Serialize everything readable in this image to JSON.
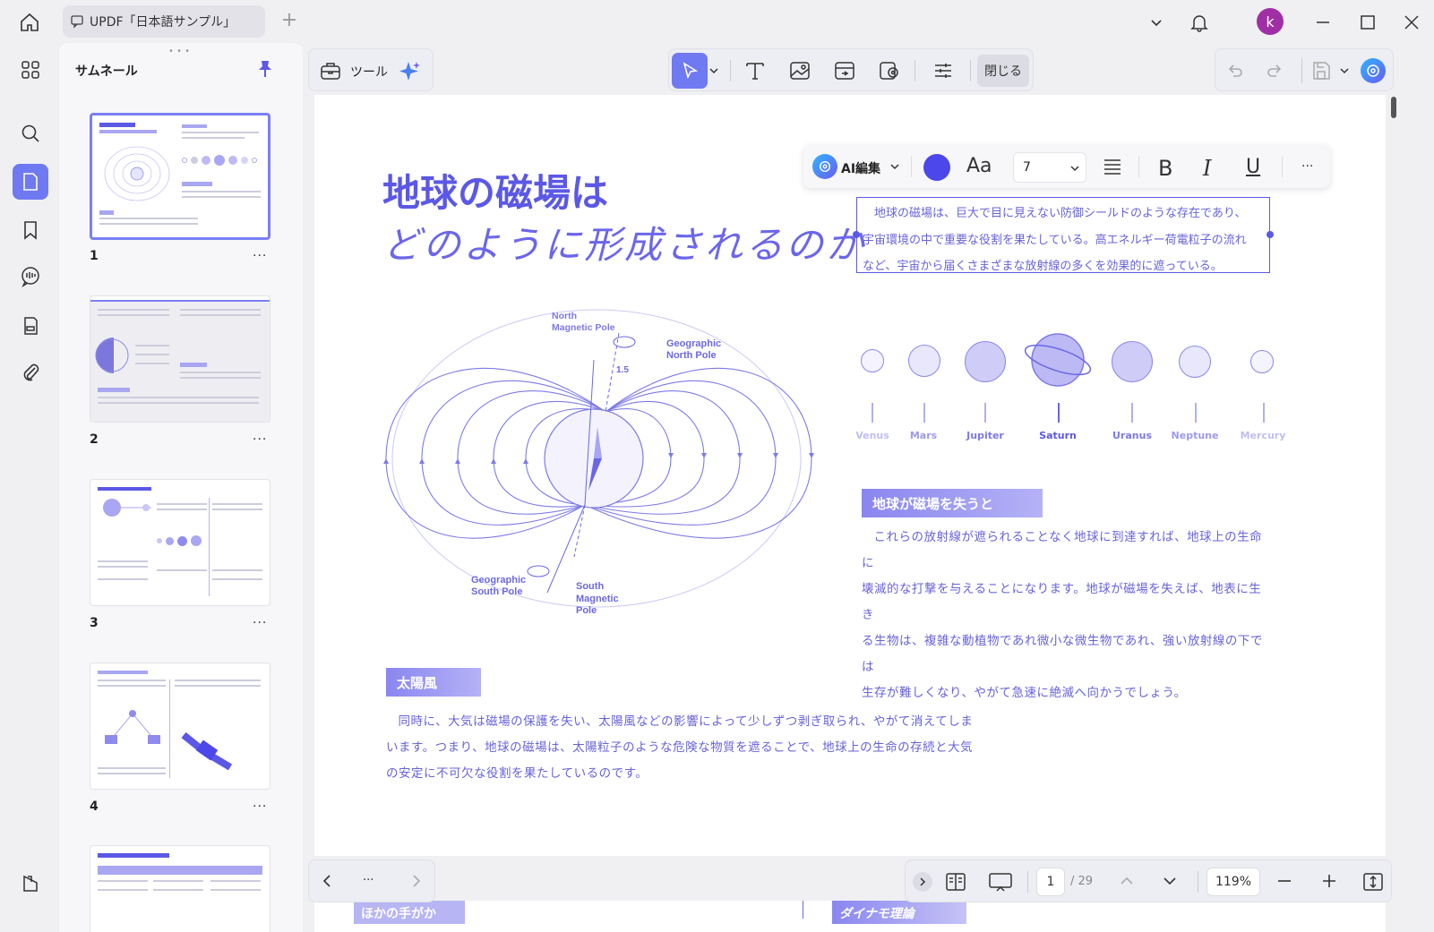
{
  "titlebar": {
    "tab_title": "UPDF「日本語サンプル」",
    "avatar_letter": "k"
  },
  "thumbnails": {
    "header": "サムネール",
    "pages": [
      {
        "number": "1",
        "more": "···"
      },
      {
        "number": "2",
        "more": "···"
      },
      {
        "number": "3",
        "more": "···"
      },
      {
        "number": "4",
        "more": "···"
      }
    ]
  },
  "toolbar": {
    "tools_label": "ツール",
    "close_label": "閉じる"
  },
  "format_bar": {
    "ai_edit_label": "AI編集",
    "font_label": "Aa",
    "font_size": "7",
    "text_color": "#4b47ea",
    "more": "···"
  },
  "document": {
    "title_line1": "地球の磁場は",
    "title_line2": "どのように形成されるのか",
    "intro_lines": [
      "地球の磁場は、巨大で目に見えない防御シールドのような存在であり、",
      "宇宙環境の中で重要な役割を果たしている。高エネルギー荷電粒子の流れ",
      "など、宇宙から届くさまざまな放射線の多くを効果的に遮っている。"
    ],
    "diagram_labels": {
      "north_magnetic_pole": [
        "North",
        "Magnetic Pole"
      ],
      "geographic_north_pole": [
        "Geographic",
        "North Pole"
      ],
      "geographic_south_pole": [
        "Geographic",
        "South Pole"
      ],
      "south_magnetic_pole": [
        "South",
        "Magnetic",
        "Pole"
      ],
      "angle": "1.5"
    },
    "planets": [
      "Venus",
      "Mars",
      "Jupiter",
      "Saturn",
      "Uranus",
      "Neptune",
      "Mercury"
    ],
    "section_loss_title": "地球が磁場を失うと",
    "section_loss_lines": [
      "これらの放射線が遮られることなく地球に到達すれば、地球上の生命に",
      "壊滅的な打撃を与えることになります。地球が磁場を失えば、地表に生き",
      "る生物は、複雑な動植物であれ微小な微生物であれ、強い放射線の下では",
      "生存が難しくなり、やがて急速に絶滅へ向かうでしょう。"
    ],
    "section_wind_title": "太陽風",
    "section_wind_lines": [
      "同時に、大気は磁場の保護を失い、太陽風などの影響によって少しずつ剥ぎ取られ、やがて消えてしま",
      "います。つまり、地球の磁場は、太陽粒子のような危険な物質を遮ることで、地球上の生命の存続と大気",
      "の安定に不可欠な役割を果たしているのです。"
    ],
    "next_page_peek": [
      "ほかの手がか",
      "ダイナモ理論"
    ]
  },
  "navigation": {
    "more": "···",
    "current_page": "1",
    "total_pages": "/ 29",
    "zoom": "119%"
  },
  "colors": {
    "accent": "#6f79f2",
    "doc_purple": "#5b58e6"
  }
}
